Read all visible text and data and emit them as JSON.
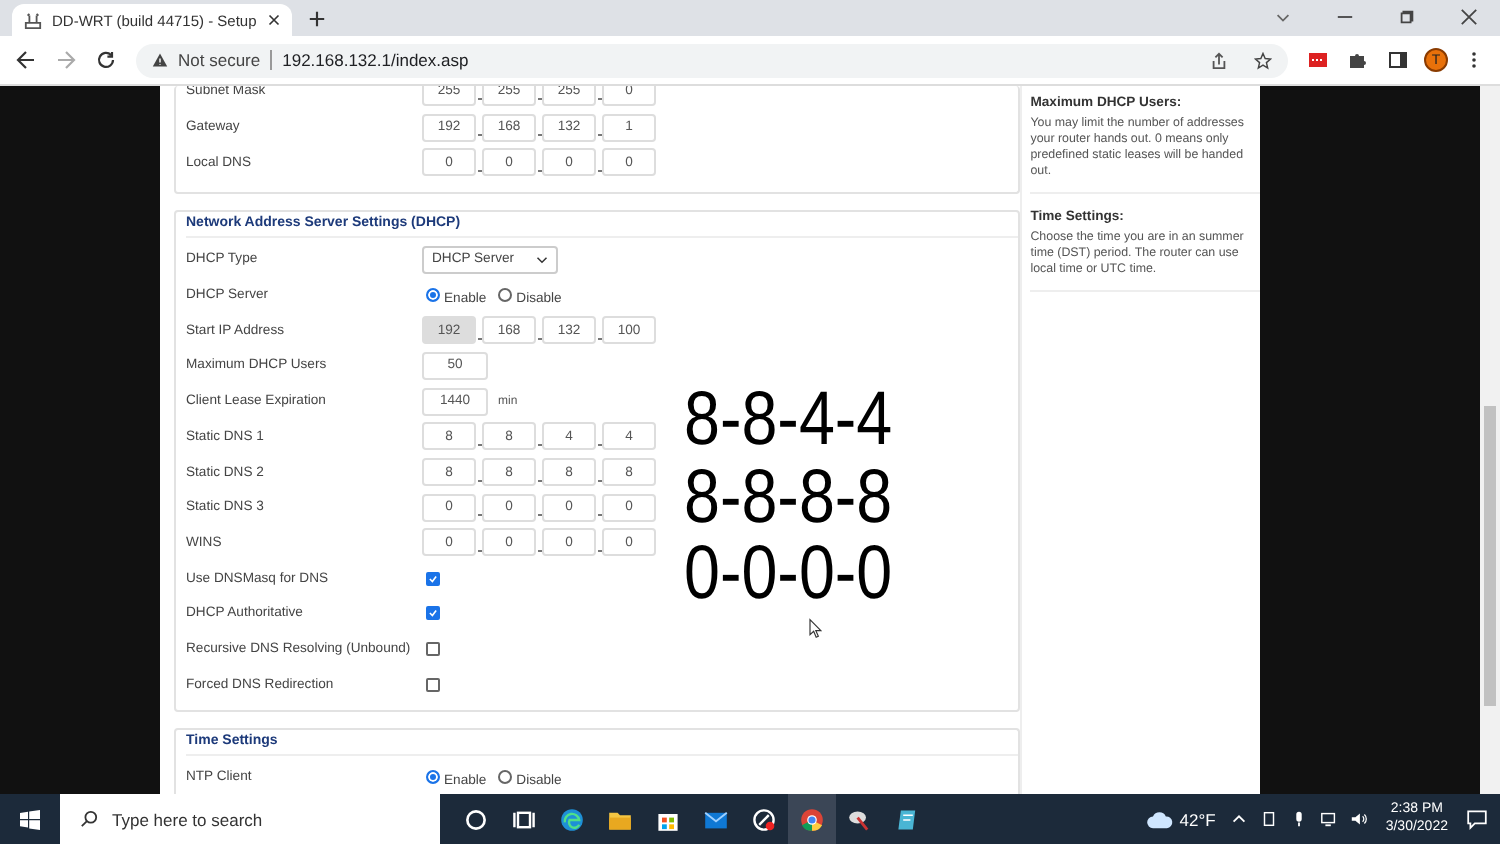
{
  "browser": {
    "tab_title": "DD-WRT (build 44715) - Setup",
    "security_label": "Not secure",
    "url": "192.168.132.1/index.asp",
    "profile_initial": "T"
  },
  "network_section": {
    "rows": [
      {
        "kind": "ip",
        "label": "Subnet Mask",
        "octets": [
          {
            "value": "255",
            "disabled": false
          },
          {
            "value": "255",
            "disabled": false
          },
          {
            "value": "255",
            "disabled": false
          },
          {
            "value": "0",
            "disabled": false
          }
        ]
      },
      {
        "kind": "ip",
        "label": "Gateway",
        "octets": [
          {
            "value": "192",
            "disabled": false
          },
          {
            "value": "168",
            "disabled": false
          },
          {
            "value": "132",
            "disabled": false
          },
          {
            "value": "1",
            "disabled": false
          }
        ]
      },
      {
        "kind": "ip",
        "label": "Local DNS",
        "octets": [
          {
            "value": "0",
            "disabled": false
          },
          {
            "value": "0",
            "disabled": false
          },
          {
            "value": "0",
            "disabled": false
          },
          {
            "value": "0",
            "disabled": false
          }
        ]
      }
    ]
  },
  "dhcp_section": {
    "title": "Network Address Server Settings (DHCP)",
    "rows": [
      {
        "kind": "select",
        "label": "DHCP Type",
        "value": "DHCP Server"
      },
      {
        "kind": "radio",
        "label": "DHCP Server",
        "options": [
          {
            "label": "Enable",
            "selected": true
          },
          {
            "label": "Disable",
            "selected": false
          }
        ]
      },
      {
        "kind": "ip",
        "label": "Start IP Address",
        "octets": [
          {
            "value": "192",
            "disabled": true
          },
          {
            "value": "168",
            "disabled": false
          },
          {
            "value": "132",
            "disabled": false
          },
          {
            "value": "100",
            "disabled": false
          }
        ]
      },
      {
        "kind": "number",
        "label": "Maximum DHCP Users",
        "value": "50"
      },
      {
        "kind": "number",
        "label": "Client Lease Expiration",
        "value": "1440",
        "unit": "min"
      },
      {
        "kind": "ip",
        "label": "Static DNS 1",
        "octets": [
          {
            "value": "8",
            "disabled": false
          },
          {
            "value": "8",
            "disabled": false
          },
          {
            "value": "4",
            "disabled": false
          },
          {
            "value": "4",
            "disabled": false
          }
        ]
      },
      {
        "kind": "ip",
        "label": "Static DNS 2",
        "octets": [
          {
            "value": "8",
            "disabled": false
          },
          {
            "value": "8",
            "disabled": false
          },
          {
            "value": "8",
            "disabled": false
          },
          {
            "value": "8",
            "disabled": false
          }
        ]
      },
      {
        "kind": "ip",
        "label": "Static DNS 3",
        "octets": [
          {
            "value": "0",
            "disabled": false
          },
          {
            "value": "0",
            "disabled": false
          },
          {
            "value": "0",
            "disabled": false
          },
          {
            "value": "0",
            "disabled": false
          }
        ]
      },
      {
        "kind": "ip",
        "label": "WINS",
        "octets": [
          {
            "value": "0",
            "disabled": false
          },
          {
            "value": "0",
            "disabled": false
          },
          {
            "value": "0",
            "disabled": false
          },
          {
            "value": "0",
            "disabled": false
          }
        ]
      },
      {
        "kind": "checkbox",
        "label": "Use DNSMasq for DNS",
        "checked": true
      },
      {
        "kind": "checkbox",
        "label": "DHCP Authoritative",
        "checked": true
      },
      {
        "kind": "checkbox",
        "label": "Recursive DNS Resolving (Unbound)",
        "checked": false
      },
      {
        "kind": "checkbox",
        "label": "Forced DNS Redirection",
        "checked": false
      }
    ]
  },
  "time_section": {
    "title": "Time Settings",
    "rows": [
      {
        "kind": "radio",
        "label": "NTP Client",
        "options": [
          {
            "label": "Enable",
            "selected": true
          },
          {
            "label": "Disable",
            "selected": false
          }
        ]
      }
    ]
  },
  "help": [
    {
      "title": "Maximum DHCP Users:",
      "text": "You may limit the number of addresses your router hands out. 0 means only predefined static leases will be handed out."
    },
    {
      "title": "Time Settings:",
      "text": "Choose the time you are in an summer time (DST) period. The router can use local time or UTC time."
    }
  ],
  "overlay_lines": [
    "8-8-4-4",
    "8-8-8-8",
    "0-0-0-0"
  ],
  "taskbar": {
    "search_placeholder": "Type here to search",
    "temperature": "42°F",
    "time": "2:38 PM",
    "date": "3/30/2022"
  }
}
